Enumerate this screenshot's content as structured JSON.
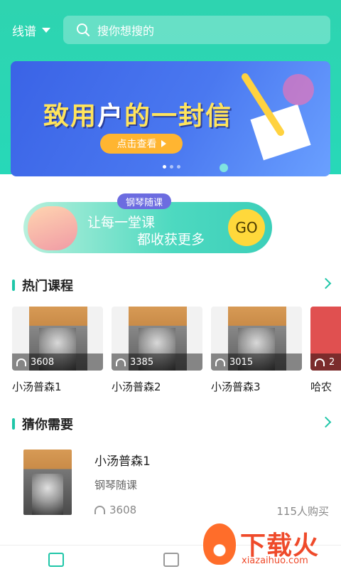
{
  "header": {
    "mode_label": "线谱",
    "search_placeholder": "搜你想搜的"
  },
  "banner": {
    "title_part1": "致用",
    "title_part2": "户",
    "title_part3": "的一封信",
    "button_label": "点击查看",
    "page_count": 3,
    "active_page": 1
  },
  "promo": {
    "tag": "钢琴随课",
    "line1": "让每一堂课",
    "line2": "都收获更多",
    "go_label": "GO"
  },
  "hot_courses": {
    "title": "热门课程",
    "items": [
      {
        "name": "小汤普森1",
        "plays": "3608"
      },
      {
        "name": "小汤普森2",
        "plays": "3385"
      },
      {
        "name": "小汤普森3",
        "plays": "3015"
      },
      {
        "name": "哈农",
        "plays": "2"
      }
    ]
  },
  "recommend": {
    "title": "猜你需要",
    "item": {
      "title": "小汤普森1",
      "category": "钢琴随课",
      "plays": "3608",
      "bought": "115人购买"
    }
  },
  "watermark": {
    "brand": "下载火",
    "domain": "xiazaihuo.com"
  },
  "colors": {
    "accent": "#1fc6a8",
    "header_bg": "#2ed4b0",
    "banner_bg": "#4a78f0",
    "banner_button": "#ffb531"
  },
  "icons": {
    "search": "search-icon",
    "dropdown": "caret-down-icon",
    "more": "chevron-right-icon",
    "headphones": "headphones-icon",
    "home_tab": "home-icon",
    "book_tab": "book-icon"
  }
}
